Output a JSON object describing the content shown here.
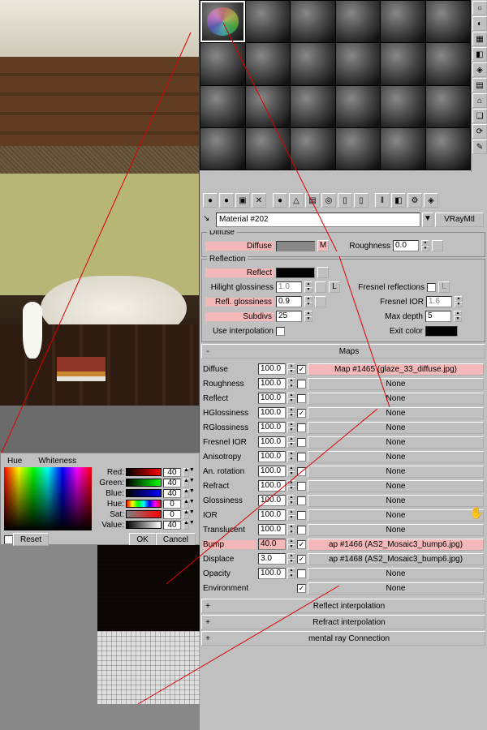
{
  "material_name": "Material #202",
  "material_type": "VRayMtl",
  "colorpicker": {
    "hue_label": "Hue",
    "whiteness_label": "Whiteness",
    "reset": "Reset",
    "ok": "OK",
    "cancel": "Cancel",
    "channels": {
      "red": {
        "label": "Red:",
        "value": "40"
      },
      "green": {
        "label": "Green:",
        "value": "40"
      },
      "blue": {
        "label": "Blue:",
        "value": "40"
      },
      "hue": {
        "label": "Hue:",
        "value": "0"
      },
      "sat": {
        "label": "Sat:",
        "value": "0"
      },
      "value": {
        "label": "Value:",
        "value": "40"
      }
    }
  },
  "diffuse_group": {
    "title": "Diffuse",
    "diffuse_label": "Diffuse",
    "m_button": "M",
    "roughness_label": "Roughness",
    "roughness_value": "0.0"
  },
  "reflection_group": {
    "title": "Reflection",
    "reflect_label": "Reflect",
    "hilight_label": "Hilight glossiness",
    "hilight_value": "1.0",
    "l_button": "L",
    "fresnel_refl_label": "Fresnel reflections",
    "refl_gloss_label": "Refl. glossiness",
    "refl_gloss_value": "0.9",
    "fresnel_ior_label": "Fresnel IOR",
    "fresnel_ior_value": "1.6",
    "subdivs_label": "Subdivs",
    "subdivs_value": "25",
    "max_depth_label": "Max depth",
    "max_depth_value": "5",
    "use_interp_label": "Use interpolation",
    "exit_color_label": "Exit color"
  },
  "maps_rollout": {
    "title": "Maps",
    "rows": [
      {
        "label": "Diffuse",
        "value": "100.0",
        "checked": true,
        "slot": "Map #1465 (glaze_33_diffuse.jpg)",
        "hl_label": false,
        "hl_slot": true
      },
      {
        "label": "Roughness",
        "value": "100.0",
        "checked": false,
        "slot": "None"
      },
      {
        "label": "Reflect",
        "value": "100.0",
        "checked": false,
        "slot": "None"
      },
      {
        "label": "HGlossiness",
        "value": "100.0",
        "checked": true,
        "slot": "None"
      },
      {
        "label": "RGlossiness",
        "value": "100.0",
        "checked": false,
        "slot": "None"
      },
      {
        "label": "Fresnel IOR",
        "value": "100.0",
        "checked": false,
        "slot": "None"
      },
      {
        "label": "Anisotropy",
        "value": "100.0",
        "checked": false,
        "slot": "None"
      },
      {
        "label": "An. rotation",
        "value": "100.0",
        "checked": false,
        "slot": "None"
      },
      {
        "label": "Refract",
        "value": "100.0",
        "checked": false,
        "slot": "None"
      },
      {
        "label": "Glossiness",
        "value": "100.0",
        "checked": false,
        "slot": "None"
      },
      {
        "label": "IOR",
        "value": "100.0",
        "checked": false,
        "slot": "None"
      },
      {
        "label": "Translucent",
        "value": "100.0",
        "checked": false,
        "slot": "None"
      },
      {
        "label": "Bump",
        "value": "40.0",
        "checked": true,
        "slot": "ap #1466 (AS2_Mosaic3_bump6.jpg)",
        "hl_label": true,
        "hl_slot": true
      },
      {
        "label": "Displace",
        "value": "3.0",
        "checked": true,
        "slot": "ap #1468 (AS2_Mosaic3_bump6.jpg)"
      },
      {
        "label": "Opacity",
        "value": "100.0",
        "checked": false,
        "slot": "None"
      },
      {
        "label": "Environment",
        "value": "",
        "checked": true,
        "slot": "None"
      }
    ]
  },
  "extra_rollouts": [
    "Reflect interpolation",
    "Refract interpolation",
    "mental ray Connection"
  ],
  "vtoolbar_icons": [
    "○",
    "◐",
    "▦",
    "◧",
    "◈",
    "▤",
    "⌂",
    "❏",
    "⟳",
    "✎"
  ],
  "htoolbar_icons": [
    "●",
    "●",
    "▣",
    "✕",
    "●",
    "△",
    "▤",
    "◎",
    "▯",
    "▯",
    "‖",
    "◧",
    "⚙",
    "◈"
  ]
}
